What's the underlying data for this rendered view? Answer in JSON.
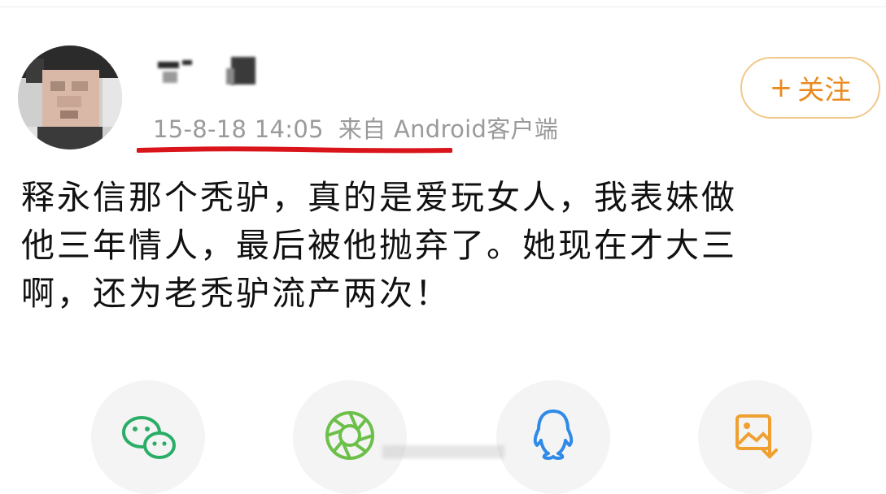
{
  "post": {
    "author_name": "",
    "timestamp": "15-8-18 14:05",
    "source": "来自 Android客户端",
    "follow_label": "关注",
    "follow_prefix": "+",
    "lines": [
      "释永信那个秃驴，真的是爱玩女人，我表妹做",
      "他三年情人，最后被他抛弃了。她现在才大三",
      "啊，还为老秃驴流产两次！"
    ]
  },
  "share": {
    "items": [
      {
        "icon": "wechat-icon"
      },
      {
        "icon": "moments-icon"
      },
      {
        "icon": "qq-icon"
      },
      {
        "icon": "save-image-icon"
      }
    ]
  },
  "colors": {
    "accent_orange": "#ea8a1e",
    "follow_border": "#f0c98a",
    "meta_gray": "#9a9a9a",
    "annotation_red": "#d9151b",
    "wechat_green": "#2aae67",
    "moments_green": "#6cc04a",
    "qq_blue": "#2f8ae8",
    "save_orange": "#f0a030"
  }
}
